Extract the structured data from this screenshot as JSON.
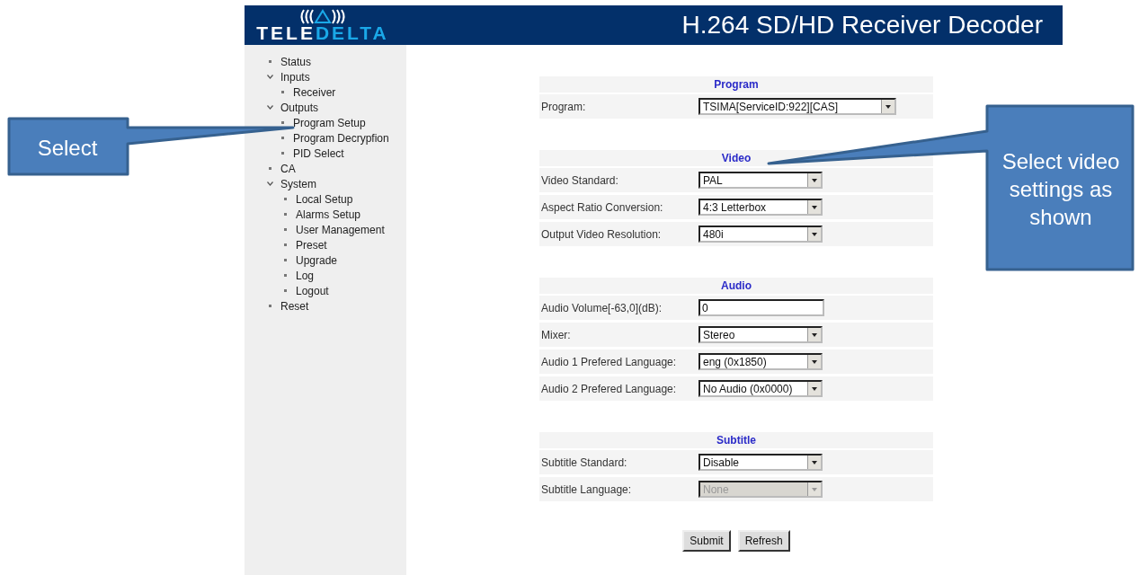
{
  "header": {
    "logo": {
      "part_1": "TELE",
      "part_2": "DELTA"
    },
    "title": "H.264 SD/HD Receiver Decoder"
  },
  "sidebar": {
    "items": [
      {
        "label": "Status"
      },
      {
        "label": "Inputs",
        "expanded": true,
        "children": [
          {
            "label": "Receiver"
          }
        ]
      },
      {
        "label": "Outputs",
        "expanded": true,
        "children": [
          {
            "label": "Program Setup"
          },
          {
            "label": "Program Decrypfion"
          },
          {
            "label": "PID Select"
          }
        ]
      },
      {
        "label": "CA"
      },
      {
        "label": "System",
        "expanded": true,
        "children": [
          {
            "label": "Local Setup"
          },
          {
            "label": "Alarms Setup"
          },
          {
            "label": "User Management"
          },
          {
            "label": "Preset"
          },
          {
            "label": "Upgrade"
          },
          {
            "label": "Log"
          },
          {
            "label": "Logout"
          }
        ]
      },
      {
        "label": "Reset"
      }
    ]
  },
  "form": {
    "sections": [
      {
        "title": "Program",
        "rows": [
          {
            "label": "Program:",
            "kind": "select",
            "value": "TSIMA[ServiceID:922][CAS]",
            "disabled": false
          }
        ]
      },
      {
        "title": "Video",
        "rows": [
          {
            "label": "Video Standard:",
            "kind": "select",
            "value": "PAL",
            "disabled": false
          },
          {
            "label": "Aspect Ratio Conversion:",
            "kind": "select",
            "value": "4:3 Letterbox",
            "disabled": false
          },
          {
            "label": "Output Video Resolution:",
            "kind": "select",
            "value": "480i",
            "disabled": false
          }
        ]
      },
      {
        "title": "Audio",
        "rows": [
          {
            "label": "Audio Volume[-63,0](dB):",
            "kind": "input",
            "value": "0"
          },
          {
            "label": "Mixer:",
            "kind": "select",
            "value": "Stereo",
            "disabled": false
          },
          {
            "label": "Audio 1 Prefered Language:",
            "kind": "select",
            "value": "eng (0x1850)",
            "disabled": false
          },
          {
            "label": "Audio 2 Prefered Language:",
            "kind": "select",
            "value": "No Audio (0x0000)",
            "disabled": false
          }
        ]
      },
      {
        "title": "Subtitle",
        "rows": [
          {
            "label": "Subtitle Standard:",
            "kind": "select",
            "value": "Disable",
            "disabled": false
          },
          {
            "label": "Subtitle Language:",
            "kind": "select",
            "value": "None",
            "disabled": true
          }
        ]
      }
    ],
    "buttons": [
      "Submit",
      "Refresh"
    ]
  },
  "callouts": [
    {
      "text": "Select"
    },
    {
      "text": "Select video settings as shown"
    }
  ]
}
